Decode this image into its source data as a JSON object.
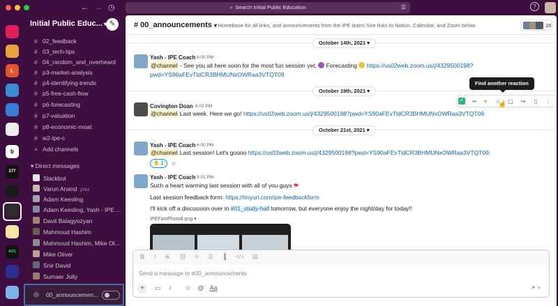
{
  "titlebar": {
    "search_placeholder": "Search Initial Public Education",
    "traffic_colors": [
      "#ff5f57",
      "#febc2e",
      "#28c840"
    ]
  },
  "workspace": {
    "name": "Initial Public Educ...",
    "rail_labels": [
      "",
      "",
      "L",
      "",
      "",
      "",
      "b",
      "277",
      "",
      "",
      "",
      "ACG",
      "",
      ""
    ]
  },
  "sidebar": {
    "channels": [
      {
        "name": "02_feedback"
      },
      {
        "name": "03_tech-tips"
      },
      {
        "name": "04_random_and_overheard"
      },
      {
        "name": "p3-market-analysis"
      },
      {
        "name": "p4-identifying-trends"
      },
      {
        "name": "p5-free-cash-flow"
      },
      {
        "name": "p6-forecasting"
      },
      {
        "name": "p7-valuation"
      },
      {
        "name": "p8-economic-moat"
      },
      {
        "name": "w2-ipe-c"
      }
    ],
    "add_channels": "Add channels",
    "dm_header": "Direct messages",
    "dms": [
      {
        "name": "Slackbot",
        "suffix": ""
      },
      {
        "name": "Varun Anand",
        "suffix": "you"
      },
      {
        "name": "Adam Keesling",
        "suffix": ""
      },
      {
        "name": "Adam Keesling, Yash - IPE ...",
        "suffix": ""
      },
      {
        "name": "Davit Balagyozyan",
        "suffix": ""
      },
      {
        "name": "Mahmoud Hashim",
        "suffix": ""
      },
      {
        "name": "Mahmoud Hashim, Mike Ol...",
        "suffix": ""
      },
      {
        "name": "Mike Oliver",
        "suffix": ""
      },
      {
        "name": "Snir David",
        "suffix": ""
      },
      {
        "name": "Sumaer Jolly",
        "suffix": ""
      }
    ],
    "huddle_label": "00_announcemen..."
  },
  "channel": {
    "name": "# 00_announcements",
    "topic": "Homebase for all links, and announcements from the IPE team! See links to Notion, Calendar, and Zoom below",
    "member_count": "16"
  },
  "dates": [
    "October 14th, 2021",
    "October 19th, 2021",
    "October 21st, 2021"
  ],
  "messages": [
    {
      "author": "Yash - IPE Coach",
      "time": "6:00 PM",
      "mention": "@channel",
      "text_a": " - See you all here soon for the most fun session yet, ",
      "text_b": " Forecasting ",
      "link": "https://us02web.zoom.us/j/4329500198?pwd=YS90aFEvTldCR3BHMUNxOWRaa3VTQT09"
    },
    {
      "author": "Covington Doan",
      "time": "6:02 PM",
      "mention": "@channel",
      "text": " Last week. Here we go! ",
      "link": "https://us02web.zoom.us/j/4329500198?pwd=YS90aFEvTldCR3BHMUNxOWRaa3VTQT09"
    },
    {
      "author": "Yash - IPE Coach",
      "time": "6:00 PM",
      "mention": "@channel",
      "text": " Last session! Let's goooo ",
      "link": "https://us02web.zoom.us/j/4329500198?pwd=YS90aFEvTldCR3BHMUNxOWRaa3VTQT09",
      "reaction_count": "1"
    },
    {
      "author": "Yash - IPE Coach",
      "time": "8:01 PM",
      "line1": "Such a heart warming last session with all of you guys",
      "line2_prefix": "Last session feedback form: ",
      "line2_link": "https://tinyurl.com/ipe-feedbackform",
      "line3_prefix": "I'll kick off a discussion over in ",
      "line3_channel": "#01_study-hall",
      "line3_suffix": " tomorrow, but everyone enjoy the night/day for today!!",
      "file_name": "IPEFamPhoto8.png"
    }
  ],
  "hover_tooltip": "Find another reaction",
  "composer": {
    "placeholder": "Send a message to #00_announcements"
  }
}
